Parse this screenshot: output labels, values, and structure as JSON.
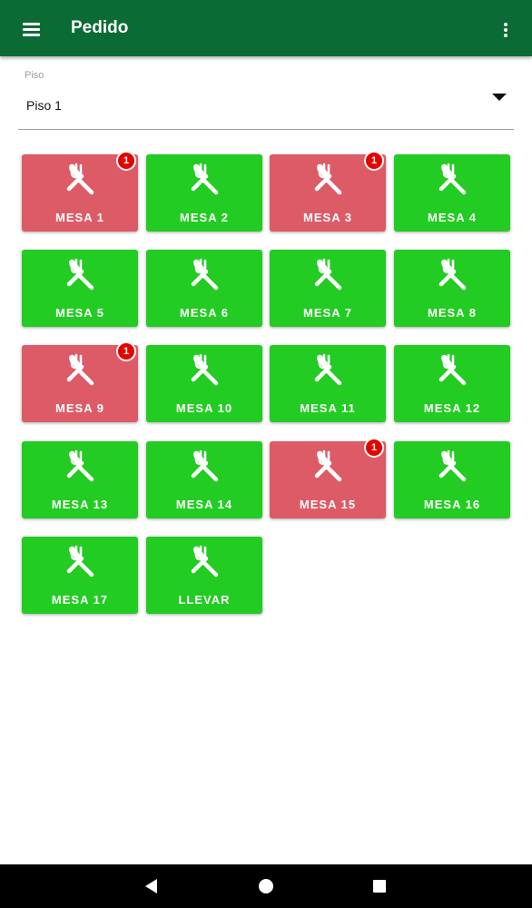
{
  "appbar": {
    "title": "Pedido",
    "menu_icon": "hamburger-menu-icon",
    "more_icon": "more-vert-icon"
  },
  "floor": {
    "label": "Piso",
    "value": "Piso 1"
  },
  "tiles": [
    {
      "label": "MESA 1",
      "status": "occupied",
      "badge": "1"
    },
    {
      "label": "MESA 2",
      "status": "free",
      "badge": null
    },
    {
      "label": "MESA 3",
      "status": "occupied",
      "badge": "1"
    },
    {
      "label": "MESA 4",
      "status": "free",
      "badge": null
    },
    {
      "label": "MESA 5",
      "status": "free",
      "badge": null
    },
    {
      "label": "MESA 6",
      "status": "free",
      "badge": null
    },
    {
      "label": "MESA 7",
      "status": "free",
      "badge": null
    },
    {
      "label": "MESA 8",
      "status": "free",
      "badge": null
    },
    {
      "label": "MESA 9",
      "status": "occupied",
      "badge": "1"
    },
    {
      "label": "MESA 10",
      "status": "free",
      "badge": null
    },
    {
      "label": "MESA 11",
      "status": "free",
      "badge": null
    },
    {
      "label": "MESA 12",
      "status": "free",
      "badge": null
    },
    {
      "label": "MESA 13",
      "status": "free",
      "badge": null
    },
    {
      "label": "MESA 14",
      "status": "free",
      "badge": null
    },
    {
      "label": "MESA 15",
      "status": "occupied",
      "badge": "1"
    },
    {
      "label": "MESA 16",
      "status": "free",
      "badge": null
    },
    {
      "label": "MESA 17",
      "status": "free",
      "badge": null
    },
    {
      "label": "LLEVAR",
      "status": "free",
      "badge": null
    }
  ],
  "colors": {
    "appbar": "#0b6b34",
    "free": "#22cc22",
    "occupied": "#dd5b66",
    "badge": "#e60000"
  },
  "tile_icon": "fork-knife-icon",
  "navbar": {
    "back_icon": "back-triangle-icon",
    "home_icon": "home-circle-icon",
    "recents_icon": "recents-square-icon"
  }
}
